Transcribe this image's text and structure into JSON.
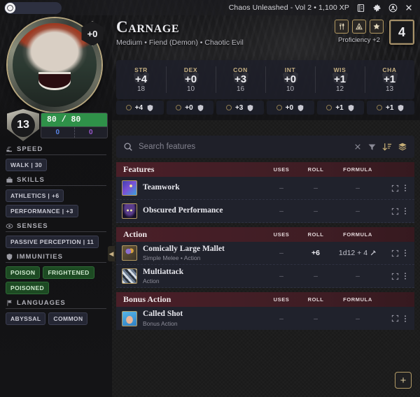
{
  "topbar": {
    "title": "Chaos Unleashed - Vol 2 • 1,100 XP",
    "logo_icon": "compass-icon",
    "icons": [
      {
        "name": "journal-icon",
        "glyph": "journal"
      },
      {
        "name": "gear-icon",
        "glyph": "gear"
      },
      {
        "name": "account-icon",
        "glyph": "account"
      },
      {
        "name": "close-icon",
        "glyph": "close"
      }
    ]
  },
  "character": {
    "name": "Carnage",
    "subtitle": "Medium • Fiend (Demon) • Chaotic Evil",
    "initiative": "+0",
    "armor_class": "13",
    "hp_current_max": "80 / 80",
    "temp_hp": "0",
    "extra_hp": "0",
    "challenge_rating": "4",
    "proficiency_label": "Proficiency +2",
    "proficiency_buttons": [
      {
        "name": "tools-icon",
        "glyph": "tools"
      },
      {
        "name": "equipment-icon",
        "glyph": "equipment"
      },
      {
        "name": "star-icon",
        "glyph": "star"
      }
    ]
  },
  "abilities": [
    {
      "name": "STR",
      "mod": "+4",
      "score": "18"
    },
    {
      "name": "DEX",
      "mod": "+0",
      "score": "10"
    },
    {
      "name": "CON",
      "mod": "+3",
      "score": "16"
    },
    {
      "name": "INT",
      "mod": "+0",
      "score": "10"
    },
    {
      "name": "WIS",
      "mod": "+1",
      "score": "12"
    },
    {
      "name": "CHA",
      "mod": "+1",
      "score": "13"
    }
  ],
  "saves": [
    {
      "ability": "STR",
      "mod": "+4"
    },
    {
      "ability": "DEX",
      "mod": "+0"
    },
    {
      "ability": "CON",
      "mod": "+3"
    },
    {
      "ability": "INT",
      "mod": "+0"
    },
    {
      "ability": "WIS",
      "mod": "+1"
    },
    {
      "ability": "CHA",
      "mod": "+1"
    }
  ],
  "sidebar": {
    "sections": [
      {
        "key": "speed",
        "label": "SPEED",
        "icon": "boot-icon",
        "chips": [
          {
            "text": "WALK | 30",
            "style": "default"
          }
        ]
      },
      {
        "key": "skills",
        "label": "SKILLS",
        "icon": "briefcase-icon",
        "chips": [
          {
            "text": "ATHLETICS | +6",
            "style": "default"
          },
          {
            "text": "PERFORMANCE | +3",
            "style": "default"
          }
        ]
      },
      {
        "key": "senses",
        "label": "SENSES",
        "icon": "eye-icon",
        "chips": [
          {
            "text": "PASSIVE PERCEPTION | 11",
            "style": "default"
          }
        ]
      },
      {
        "key": "immunities",
        "label": "IMMUNITIES",
        "icon": "shield-icon",
        "chips": [
          {
            "text": "POISON",
            "style": "green"
          },
          {
            "text": "FRIGHTENED",
            "style": "green"
          },
          {
            "text": "POISONED",
            "style": "green"
          }
        ]
      },
      {
        "key": "languages",
        "label": "LANGUAGES",
        "icon": "flag-icon",
        "chips": [
          {
            "text": "ABYSSAL",
            "style": "default"
          },
          {
            "text": "COMMON",
            "style": "default"
          }
        ]
      }
    ],
    "collapse_glyph": "◀"
  },
  "search": {
    "placeholder": "Search features",
    "value": "",
    "actions": [
      {
        "name": "clear-icon",
        "glyph": "close",
        "gold": false
      },
      {
        "name": "filter-icon",
        "glyph": "funnel",
        "gold": false
      },
      {
        "name": "sort-icon",
        "glyph": "sort",
        "gold": true
      },
      {
        "name": "layers-icon",
        "glyph": "layers",
        "gold": true
      }
    ]
  },
  "table": {
    "columns": {
      "uses": "USES",
      "roll": "ROLL",
      "formula": "FORMULA"
    },
    "groups": [
      {
        "title": "Features",
        "rows": [
          {
            "name": "Teamwork",
            "sub": "",
            "uses": "–",
            "roll": "–",
            "formula": "–",
            "icon": "teamwork-icon",
            "formula_icon": ""
          },
          {
            "name": "Obscured Performance",
            "sub": "",
            "uses": "–",
            "roll": "–",
            "formula": "–",
            "icon": "obscured-performance-icon",
            "formula_icon": ""
          }
        ]
      },
      {
        "title": "Action",
        "rows": [
          {
            "name": "Comically Large Mallet",
            "sub": "Simple Melee • Action",
            "uses": "–",
            "roll": "+6",
            "formula": "1d12 + 4",
            "icon": "mallet-icon",
            "formula_icon": "hammer-icon"
          },
          {
            "name": "Multiattack",
            "sub": "Action",
            "uses": "–",
            "roll": "–",
            "formula": "–",
            "icon": "multiattack-icon",
            "formula_icon": ""
          }
        ]
      },
      {
        "title": "Bonus Action",
        "rows": [
          {
            "name": "Called Shot",
            "sub": "Bonus Action",
            "uses": "–",
            "roll": "–",
            "formula": "–",
            "icon": "called-shot-icon",
            "formula_icon": ""
          }
        ]
      }
    ]
  },
  "footer": {
    "add_label": "+"
  },
  "colors": {
    "accent_gold": "#b49a62",
    "group_header": "#4a1f28",
    "hp_green": "#2f9149",
    "temp_hp_blue": "#5a86e8",
    "extra_hp_purple": "#9b59d0",
    "immunity_green": "#1d4a23",
    "panel": "#20222c"
  }
}
